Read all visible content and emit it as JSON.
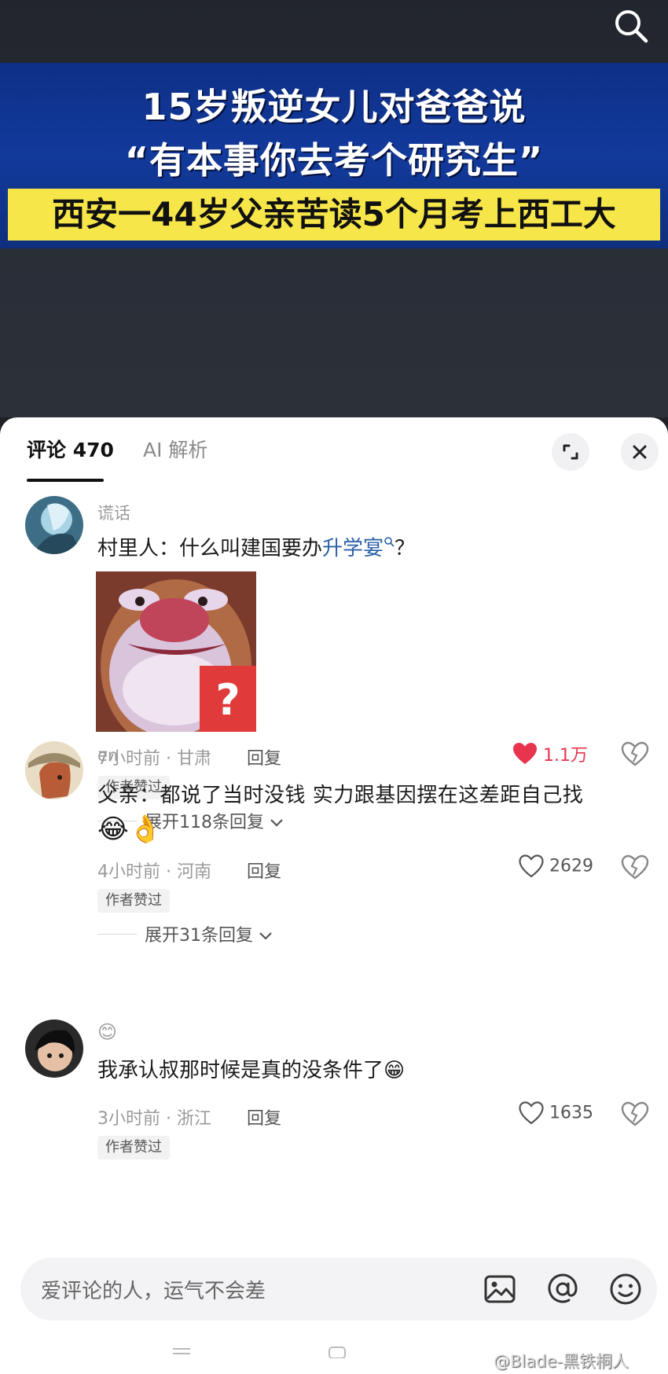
{
  "video": {
    "banner_line1": "15岁叛逆女儿对爸爸说",
    "banner_line2": "“有本事你去考个研究生”",
    "banner_line3": "西安一44岁父亲苦读5个月考上西工大"
  },
  "sheet": {
    "tabs": [
      {
        "label": "评论 470",
        "active": true
      },
      {
        "label": "AI 解析",
        "active": false
      }
    ],
    "icons": {
      "expand": "expand-icon",
      "close": "close-icon"
    }
  },
  "comments": [
    {
      "username": "谎话",
      "text_before": "村里人：什么叫建国要办",
      "link_text": "升学宴",
      "text_after": "？",
      "time_location": "7小时前 · 甘肃",
      "reply_label": "回复",
      "likes": "1.1万",
      "liked": true,
      "badge": "作者赞过",
      "expand_replies": "展开118条回复"
    },
    {
      "username": "en",
      "text": "父亲：都说了当时没钱 实力跟基因摆在这差距自己找",
      "emojis": "😂👌",
      "time_location": "4小时前 · 河南",
      "reply_label": "回复",
      "likes": "2629",
      "liked": false,
      "badge": "作者赞过",
      "expand_replies": "展开31条回复"
    },
    {
      "username": "😊",
      "text": "我承认叔那时候是真的没条件了😁",
      "time_location": "3小时前 · 浙江",
      "reply_label": "回复",
      "likes": "1635",
      "liked": false,
      "badge": "作者赞过"
    }
  ],
  "input": {
    "placeholder": "爱评论的人，运气不会差",
    "icons": [
      "image-icon",
      "at-icon",
      "emoji-icon"
    ]
  },
  "watermark": "@Blade-黑铁桐人",
  "colors": {
    "banner_blue": "#123a9c",
    "banner_yellow": "#f6e64a",
    "like_red": "#e8344e",
    "link_blue": "#2a5fa8"
  }
}
